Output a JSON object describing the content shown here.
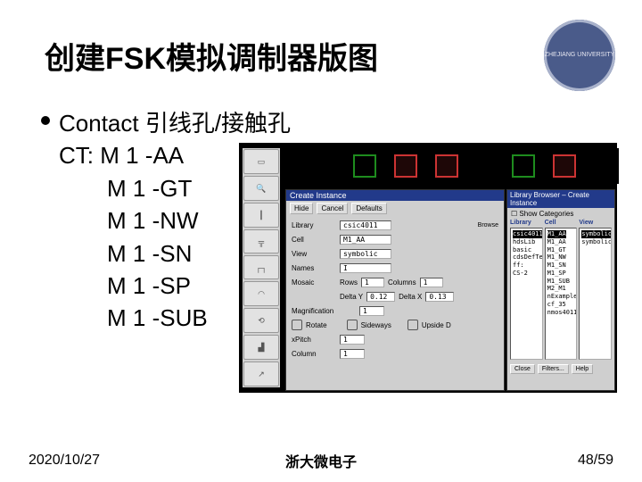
{
  "title": "创建FSK模拟调制器版图",
  "logo_text": "ZHEJIANG\nUNIVERSITY",
  "heading": "Contact 引线孔/接触孔",
  "ct_label": "CT: M 1 -AA",
  "ct_items": [
    "M 1 -GT",
    "M 1 -NW",
    "M 1 -SN",
    "M 1 -SP",
    "M 1 -SUB"
  ],
  "screenshot": {
    "create_instance": {
      "title": "Create Instance",
      "buttons": [
        "Hide",
        "Cancel",
        "Defaults"
      ],
      "fields": {
        "library_label": "Library",
        "library_value": "csic4011",
        "cell_label": "Cell",
        "cell_value": "M1_AA",
        "view_label": "View",
        "view_value": "symbolic",
        "names_label": "Names",
        "names_value": "I",
        "mosaic_label": "Mosaic",
        "rows_label": "Rows",
        "rows_value": "1",
        "columns_label": "Columns",
        "columns_value": "1",
        "deltay_label": "Delta Y",
        "deltay_value": "0.12",
        "deltax_label": "Delta X",
        "deltax_value": "0.13",
        "mag_label": "Magnification",
        "mag_value": "1",
        "rotate_label": "Rotate",
        "sideways_label": "Sideways",
        "upside_label": "Upside D",
        "xpitch_label": "xPitch",
        "xpitch_value": "1",
        "column_label": "Column",
        "column_value": "1"
      }
    },
    "library_browser": {
      "title": "Library Browser – Create Instance",
      "show_categories": "Show Categories",
      "col_headers": {
        "lib": "Library",
        "cell": "Cell",
        "view": "View"
      },
      "lib_selected": "csic4011",
      "lib_items": [
        "hdsLib",
        "basic",
        "cdsDefTec",
        "ff:",
        "CS-2"
      ],
      "cell_selected": "M1_AA",
      "cell_items": [
        "M1_AA",
        "M1_GT",
        "M1_NW",
        "M1_SN",
        "M1_SP",
        "M1_SUB",
        "M2_M1",
        "nExample",
        "cf_35",
        "nmos4011"
      ],
      "view_selected": "symbolic",
      "view_items": [
        "symbolic"
      ],
      "buttons": [
        "Close",
        "Filters...",
        "Help"
      ]
    }
  },
  "footer": {
    "date": "2020/10/27",
    "center": "浙大微电子",
    "page": "48/59"
  }
}
